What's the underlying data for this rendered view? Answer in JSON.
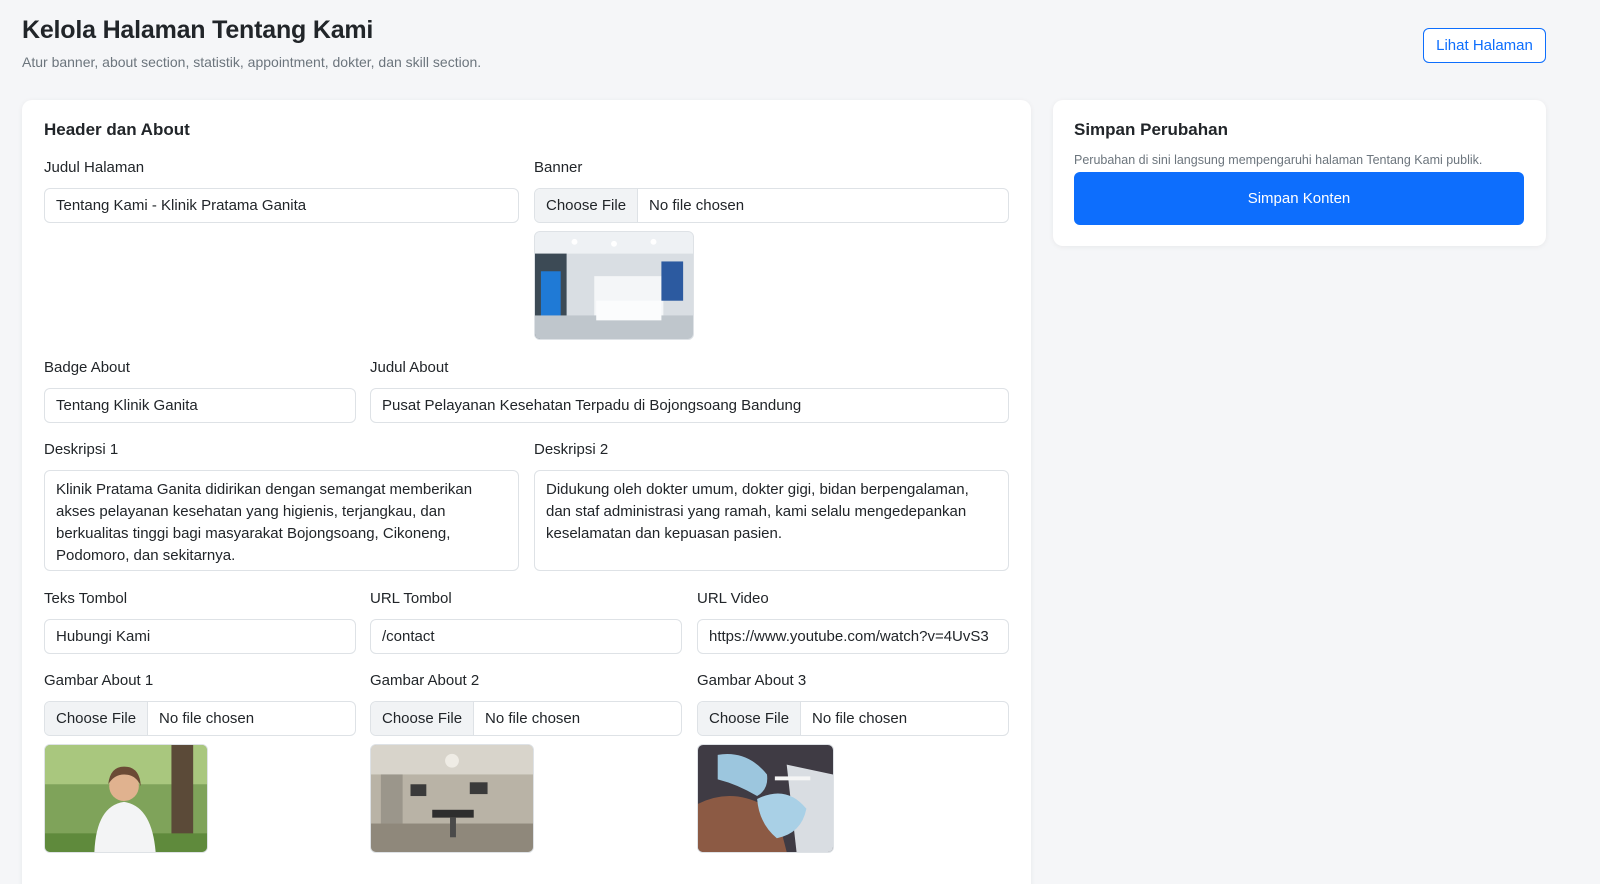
{
  "header": {
    "title": "Kelola Halaman Tentang Kami",
    "subtitle": "Atur banner, about section, statistik, appointment, dokter, dan skill section.",
    "view_button": "Lihat Halaman"
  },
  "main": {
    "title": "Header dan About",
    "fields": {
      "judul_halaman": {
        "label": "Judul Halaman",
        "value": "Tentang Kami - Klinik Pratama Ganita"
      },
      "banner": {
        "label": "Banner",
        "button": "Choose File",
        "status": "No file chosen"
      },
      "badge_about": {
        "label": "Badge About",
        "value": "Tentang Klinik Ganita"
      },
      "judul_about": {
        "label": "Judul About",
        "value": "Pusat Pelayanan Kesehatan Terpadu di Bojongsoang Bandung"
      },
      "deskripsi_1": {
        "label": "Deskripsi 1",
        "value": "Klinik Pratama Ganita didirikan dengan semangat memberikan akses pelayanan kesehatan yang higienis, terjangkau, dan berkualitas tinggi bagi masyarakat Bojongsoang, Cikoneng, Podomoro, dan sekitarnya."
      },
      "deskripsi_2": {
        "label": "Deskripsi 2",
        "value": "Didukung oleh dokter umum, dokter gigi, bidan berpengalaman, dan staf administrasi yang ramah, kami selalu mengedepankan keselamatan dan kepuasan pasien."
      },
      "teks_tombol": {
        "label": "Teks Tombol",
        "value": "Hubungi Kami"
      },
      "url_tombol": {
        "label": "URL Tombol",
        "value": "/contact"
      },
      "url_video": {
        "label": "URL Video",
        "value": "https://www.youtube.com/watch?v=4UvS3"
      },
      "gambar_1": {
        "label": "Gambar About 1",
        "button": "Choose File",
        "status": "No file chosen"
      },
      "gambar_2": {
        "label": "Gambar About 2",
        "button": "Choose File",
        "status": "No file chosen"
      },
      "gambar_3": {
        "label": "Gambar About 3",
        "button": "Choose File",
        "status": "No file chosen"
      }
    }
  },
  "sidebar": {
    "title": "Simpan Perubahan",
    "note": "Perubahan di sini langsung mempengaruhi halaman Tentang Kami publik.",
    "save_button": "Simpan Konten"
  },
  "colors": {
    "primary": "#0d6efd",
    "background": "#f5f6f8",
    "muted": "#6c757d",
    "border": "#dee2e6"
  }
}
